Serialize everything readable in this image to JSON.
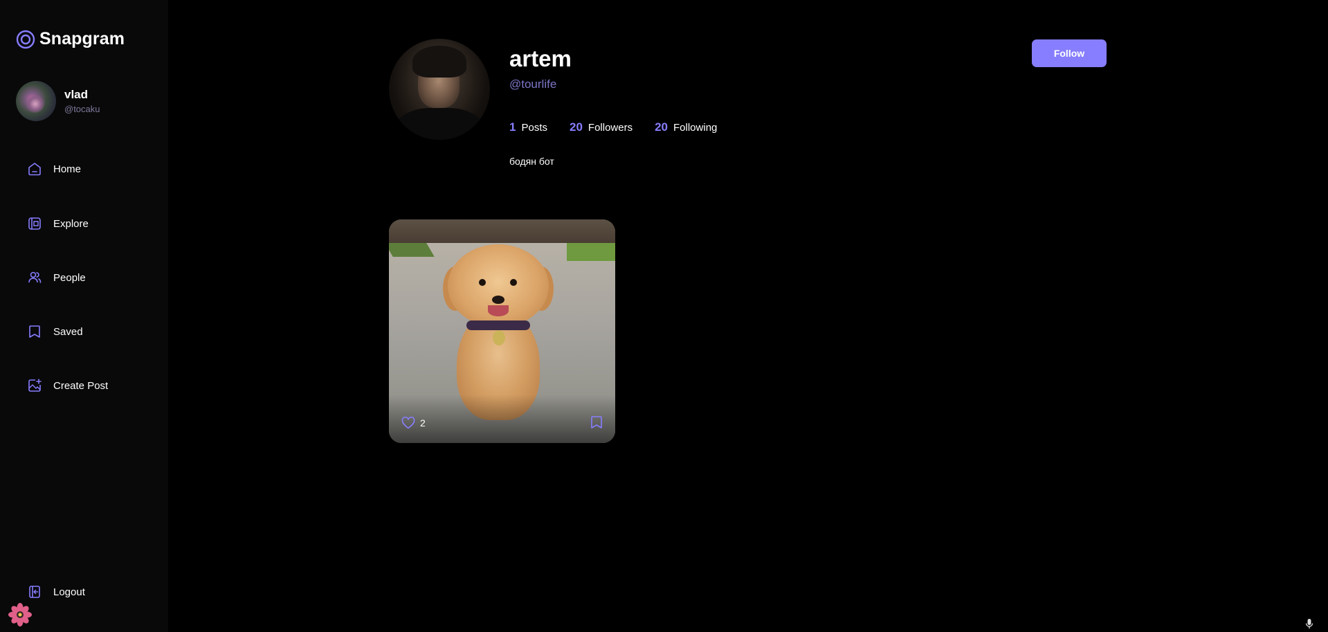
{
  "app": {
    "name": "Snapgram"
  },
  "current_user": {
    "name": "vlad",
    "handle": "@tocaku"
  },
  "nav": {
    "items": [
      {
        "label": "Home",
        "icon": "home-icon"
      },
      {
        "label": "Explore",
        "icon": "explore-icon"
      },
      {
        "label": "People",
        "icon": "people-icon"
      },
      {
        "label": "Saved",
        "icon": "bookmark-icon"
      },
      {
        "label": "Create Post",
        "icon": "create-post-icon"
      }
    ],
    "logout": "Logout"
  },
  "profile": {
    "name": "artem",
    "handle": "@tourlife",
    "bio": "бодян бот",
    "follow_label": "Follow",
    "stats": {
      "posts": {
        "value": "1",
        "label": "Posts"
      },
      "followers": {
        "value": "20",
        "label": "Followers"
      },
      "following": {
        "value": "20",
        "label": "Following"
      }
    }
  },
  "posts": [
    {
      "image": "golden-retriever-puppy",
      "likes": "2"
    }
  ],
  "colors": {
    "accent": "#877eff",
    "sidebar": "#09090a",
    "background": "#000000",
    "handle": "#7b76c7"
  }
}
